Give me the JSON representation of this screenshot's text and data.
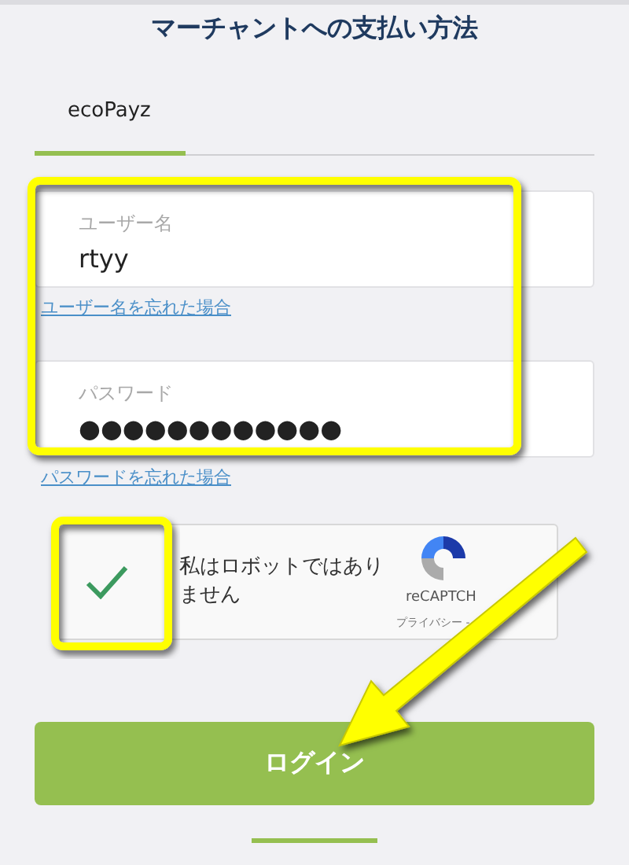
{
  "header": {
    "title": "マーチャントへの支払い方法"
  },
  "tabs": [
    {
      "label": "ecoPayz",
      "selected": true
    }
  ],
  "fields": [
    {
      "label": "ユーザー名",
      "value": "rtyy",
      "link": "ユーザー名を忘れた場合"
    },
    {
      "label": "パスワード",
      "value": "●●●●●●●●●●●●",
      "link": "パスワードを忘れた場合"
    }
  ],
  "captcha": {
    "label": "私はロボットではありません",
    "checked": true,
    "brand": "reCAPTCH",
    "terms": "プライバシー -"
  },
  "login_button": "ログイン"
}
